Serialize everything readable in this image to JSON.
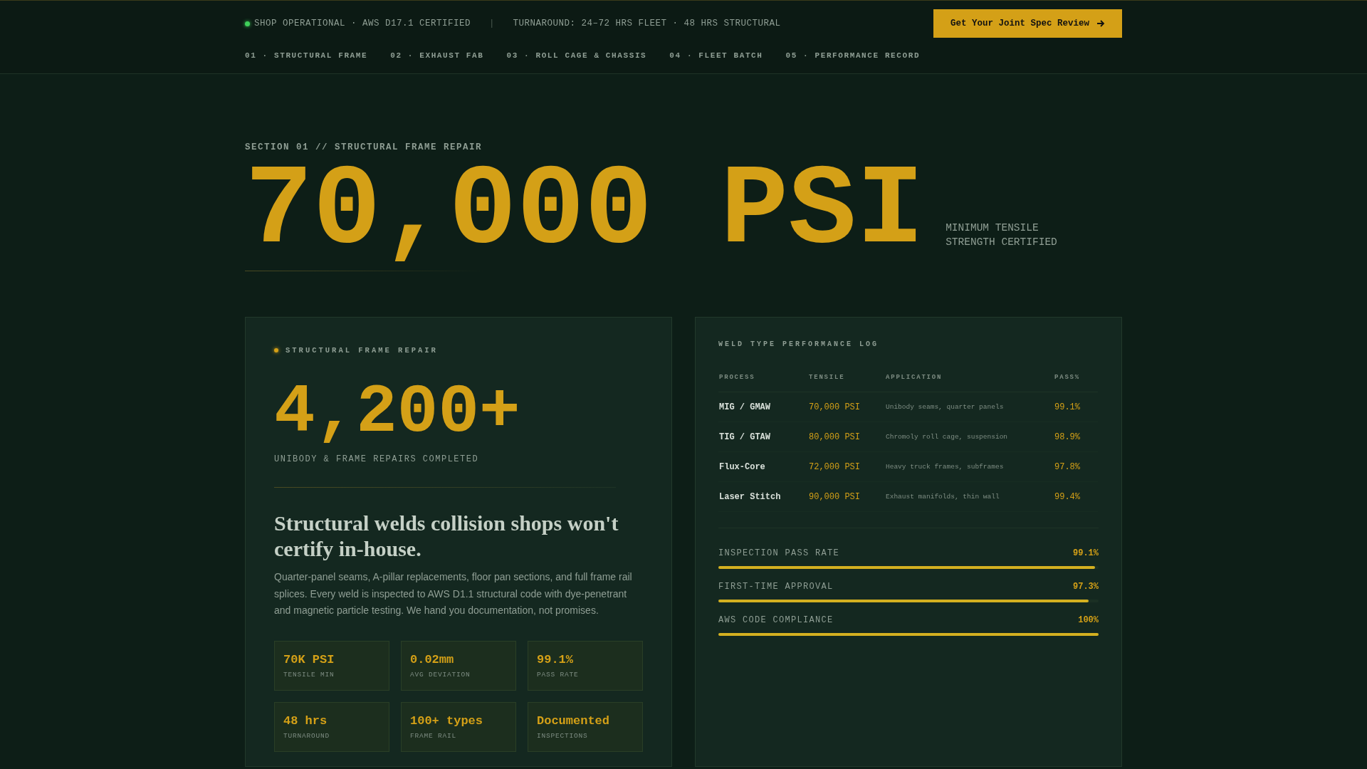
{
  "top_bar": {
    "status": "SHOP OPERATIONAL · AWS D17.1 CERTIFIED",
    "separator": "|",
    "turnaround": "TURNAROUND: 24–72 HRS FLEET · 48 HRS STRUCTURAL",
    "cta": "Get Your Joint Spec Review"
  },
  "nav": [
    {
      "label": "01 · STRUCTURAL FRAME"
    },
    {
      "label": "02 · EXHAUST FAB"
    },
    {
      "label": "03 · ROLL CAGE & CHASSIS"
    },
    {
      "label": "04 · FLEET BATCH"
    },
    {
      "label": "05 · PERFORMANCE RECORD"
    }
  ],
  "hero": {
    "eyebrow": "SECTION 01 // STRUCTURAL FRAME REPAIR",
    "figure": "70,000 PSI",
    "caption": "MINIMUM TENSILE STRENGTH CERTIFIED"
  },
  "frame_card": {
    "tag": "STRUCTURAL FRAME REPAIR",
    "count": "4,200+",
    "count_label": "UNIBODY & FRAME REPAIRS COMPLETED",
    "heading": "Structural welds collision shops won't certify in-house.",
    "body": "Quarter-panel seams, A-pillar replacements, floor pan sections, and full frame rail splices. Every weld is inspected to AWS D1.1 structural code with dye-penetrant and magnetic particle testing. We hand you documentation, not promises.",
    "stats": [
      {
        "value": "70K PSI",
        "label": "TENSILE MIN"
      },
      {
        "value": "0.02mm",
        "label": "AVG DEVIATION"
      },
      {
        "value": "99.1%",
        "label": "PASS RATE"
      },
      {
        "value": "48 hrs",
        "label": "TURNAROUND"
      },
      {
        "value": "100+ types",
        "label": "FRAME RAIL"
      },
      {
        "value": "Documented",
        "label": "INSPECTIONS"
      }
    ]
  },
  "weld_log": {
    "title": "WELD TYPE PERFORMANCE LOG",
    "columns": [
      "PROCESS",
      "TENSILE",
      "APPLICATION",
      "PASS%"
    ],
    "rows": [
      {
        "process": "MIG / GMAW",
        "tensile": "70,000 PSI",
        "application": "Unibody seams, quarter panels",
        "pass": "99.1%"
      },
      {
        "process": "TIG / GTAW",
        "tensile": "80,000 PSI",
        "application": "Chromoly roll cage, suspension",
        "pass": "98.9%"
      },
      {
        "process": "Flux-Core",
        "tensile": "72,000 PSI",
        "application": "Heavy truck frames, subframes",
        "pass": "97.8%"
      },
      {
        "process": "Laser Stitch",
        "tensile": "90,000 PSI",
        "application": "Exhaust manifolds, thin wall",
        "pass": "99.4%"
      }
    ],
    "meters": [
      {
        "label": "INSPECTION PASS RATE",
        "reading": "99.1%",
        "level": 0.991
      },
      {
        "label": "FIRST-TIME APPROVAL",
        "reading": "97.3%",
        "level": 0.973
      },
      {
        "label": "AWS CODE COMPLIANCE",
        "reading": "100%",
        "level": 1
      }
    ]
  }
}
